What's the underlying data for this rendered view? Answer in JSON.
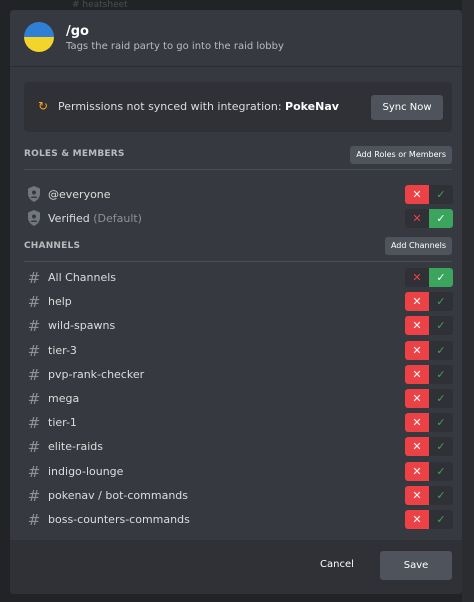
{
  "background": {
    "peek_text": "# heatsheet"
  },
  "command": {
    "name": "/go",
    "description": "Tags the raid party to go into the raid lobby"
  },
  "permissions_notice": {
    "text": "Permissions not synced with integration:",
    "integration": "PokeNav",
    "sync_button": "Sync Now"
  },
  "roles_section": {
    "title": "ROLES & MEMBERS",
    "add_button": "Add Roles or Members",
    "items": [
      {
        "name": "@everyone",
        "suffix": "",
        "state": "deny"
      },
      {
        "name": "Verified",
        "suffix": "(Default)",
        "state": "allow"
      }
    ]
  },
  "channels_section": {
    "title": "CHANNELS",
    "add_button": "Add Channels",
    "items": [
      {
        "name": "All Channels",
        "state": "allow"
      },
      {
        "name": "help",
        "state": "deny"
      },
      {
        "name": "wild-spawns",
        "state": "deny"
      },
      {
        "name": "tier-3",
        "state": "deny"
      },
      {
        "name": "pvp-rank-checker",
        "state": "deny"
      },
      {
        "name": "mega",
        "state": "deny"
      },
      {
        "name": "tier-1",
        "state": "deny"
      },
      {
        "name": "elite-raids",
        "state": "deny"
      },
      {
        "name": "indigo-lounge",
        "state": "deny"
      },
      {
        "name": "pokenav / bot-commands",
        "state": "deny"
      },
      {
        "name": "boss-counters-commands",
        "state": "deny"
      }
    ]
  },
  "toggle_glyphs": {
    "deny": "✕",
    "allow": "✓"
  },
  "footer": {
    "cancel": "Cancel",
    "save": "Save"
  },
  "colors": {
    "deny": "#ed4245",
    "allow": "#3ba55d",
    "warning": "#faa61a"
  }
}
